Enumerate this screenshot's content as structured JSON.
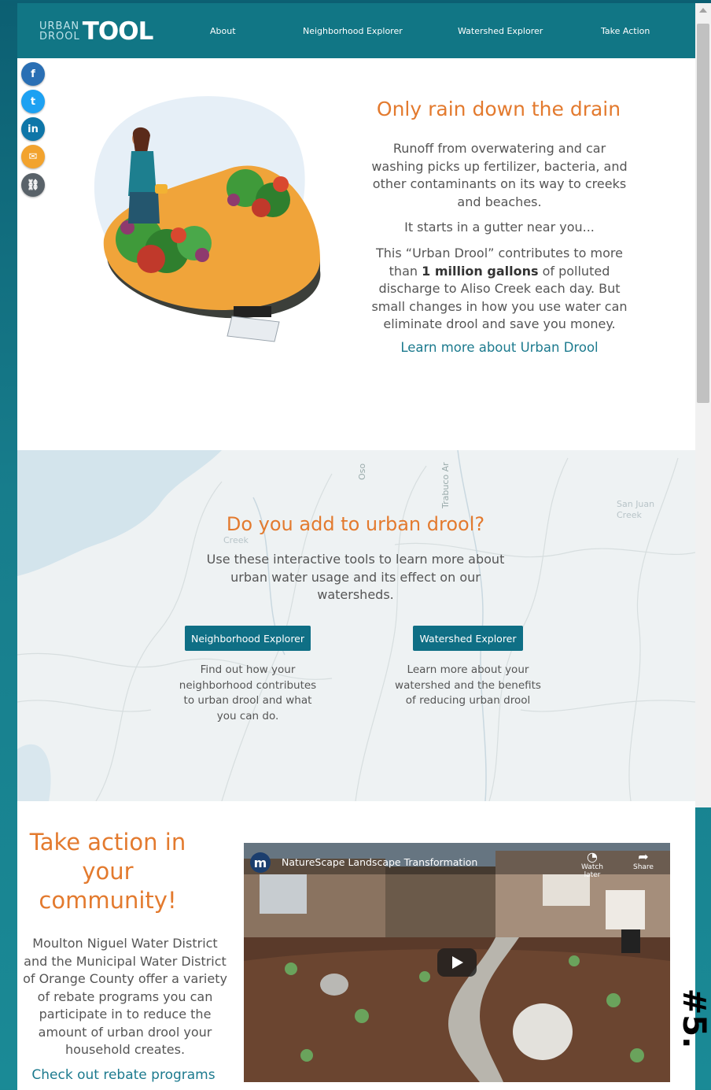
{
  "header": {
    "logo_small_top": "URBAN",
    "logo_small_bottom": "DROOL",
    "logo_big": "TOOL",
    "nav": [
      "About",
      "Neighborhood Explorer",
      "Watershed Explorer",
      "Take Action"
    ]
  },
  "social": [
    {
      "icon": "facebook-icon",
      "glyph": "f",
      "color": "#2a6fb4"
    },
    {
      "icon": "twitter-icon",
      "glyph": "t",
      "color": "#1da1f2"
    },
    {
      "icon": "linkedin-icon",
      "glyph": "in",
      "color": "#0e76a8"
    },
    {
      "icon": "email-icon",
      "glyph": "✉",
      "color": "#f2a32e"
    },
    {
      "icon": "link-icon",
      "glyph": "⛓",
      "color": "#596269"
    }
  ],
  "hero": {
    "title": "Only rain down the drain",
    "p1": "Runoff from overwatering and car washing picks up fertilizer, bacteria, and other contaminants on its way to creeks and beaches.",
    "p2": "It starts in a gutter near you...",
    "p3_before": "This “Urban Drool” contributes to more than ",
    "p3_bold": "1 million gallons",
    "p3_after": " of polluted discharge to Aliso Creek each day. But small changes in how you use water can eliminate drool and save you money.",
    "link": "Learn more about Urban Drool"
  },
  "map": {
    "title": "Do you add to urban drool?",
    "intro": "Use these interactive tools to learn more about urban water usage and its effect on our watersheds.",
    "labels": [
      "Oso",
      "Trabuco Ar",
      "San Juan Creek",
      "Creek"
    ],
    "buttons": [
      {
        "label": "Neighborhood Explorer",
        "desc": "Find out how your neighborhood contributes to urban drool and what you can do."
      },
      {
        "label": "Watershed Explorer",
        "desc": "Learn more about your watershed and the benefits of reducing urban drool"
      }
    ]
  },
  "action": {
    "title": "Take action in your community!",
    "body": "Moulton Niguel Water District and the Municipal Water District of Orange County offer a variety of rebate programs you can participate in to reduce the amount of urban drool your household creates.",
    "link": "Check out rebate programs"
  },
  "video": {
    "channel_glyph": "m",
    "title": "NatureScape Landscape Transformation",
    "watch_later": "Watch later",
    "share": "Share"
  },
  "badge": "#5."
}
